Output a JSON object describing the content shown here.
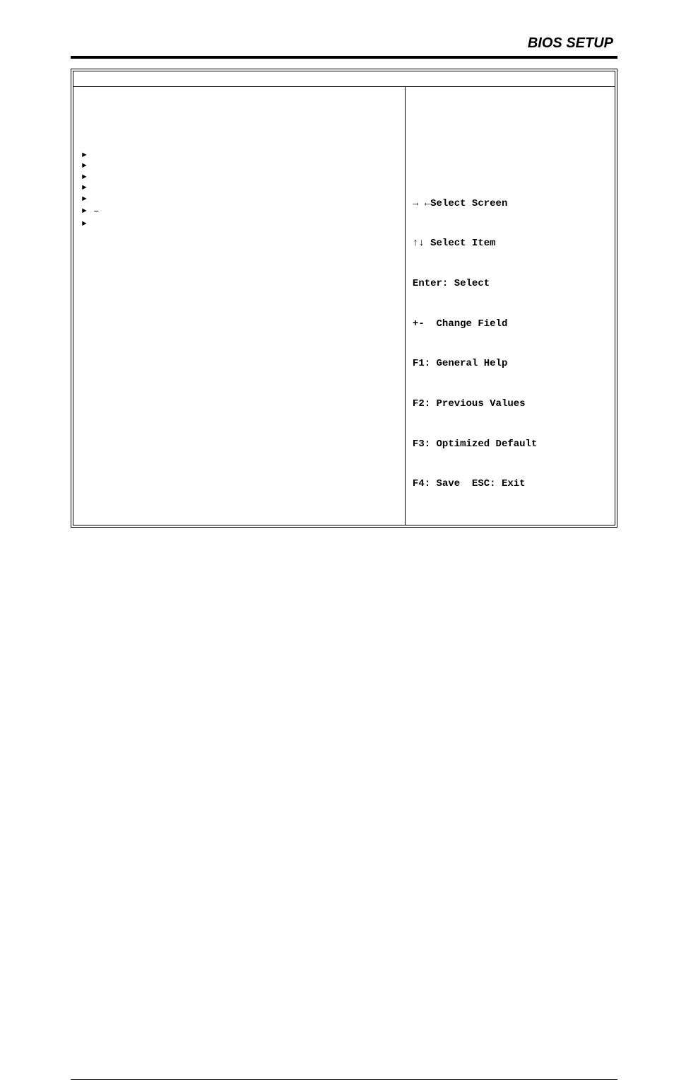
{
  "header": {
    "title": "BIOS SETUP"
  },
  "bios": {
    "menubar": "",
    "left_items": [
      "",
      "",
      "",
      "",
      "",
      "–",
      ""
    ],
    "help": {
      "line1": "→ ←Select Screen",
      "line2": "↑↓ Select Item",
      "line3": "Enter: Select",
      "line4": "+-  Change Field",
      "line5": "F1: General Help",
      "line6": "F2: Previous Values",
      "line7": "F3: Optimized Default",
      "line8": "F4: Save  ESC: Exit"
    }
  },
  "footer": {
    "left": "",
    "right": ""
  },
  "icons": {
    "submenu": "►"
  }
}
